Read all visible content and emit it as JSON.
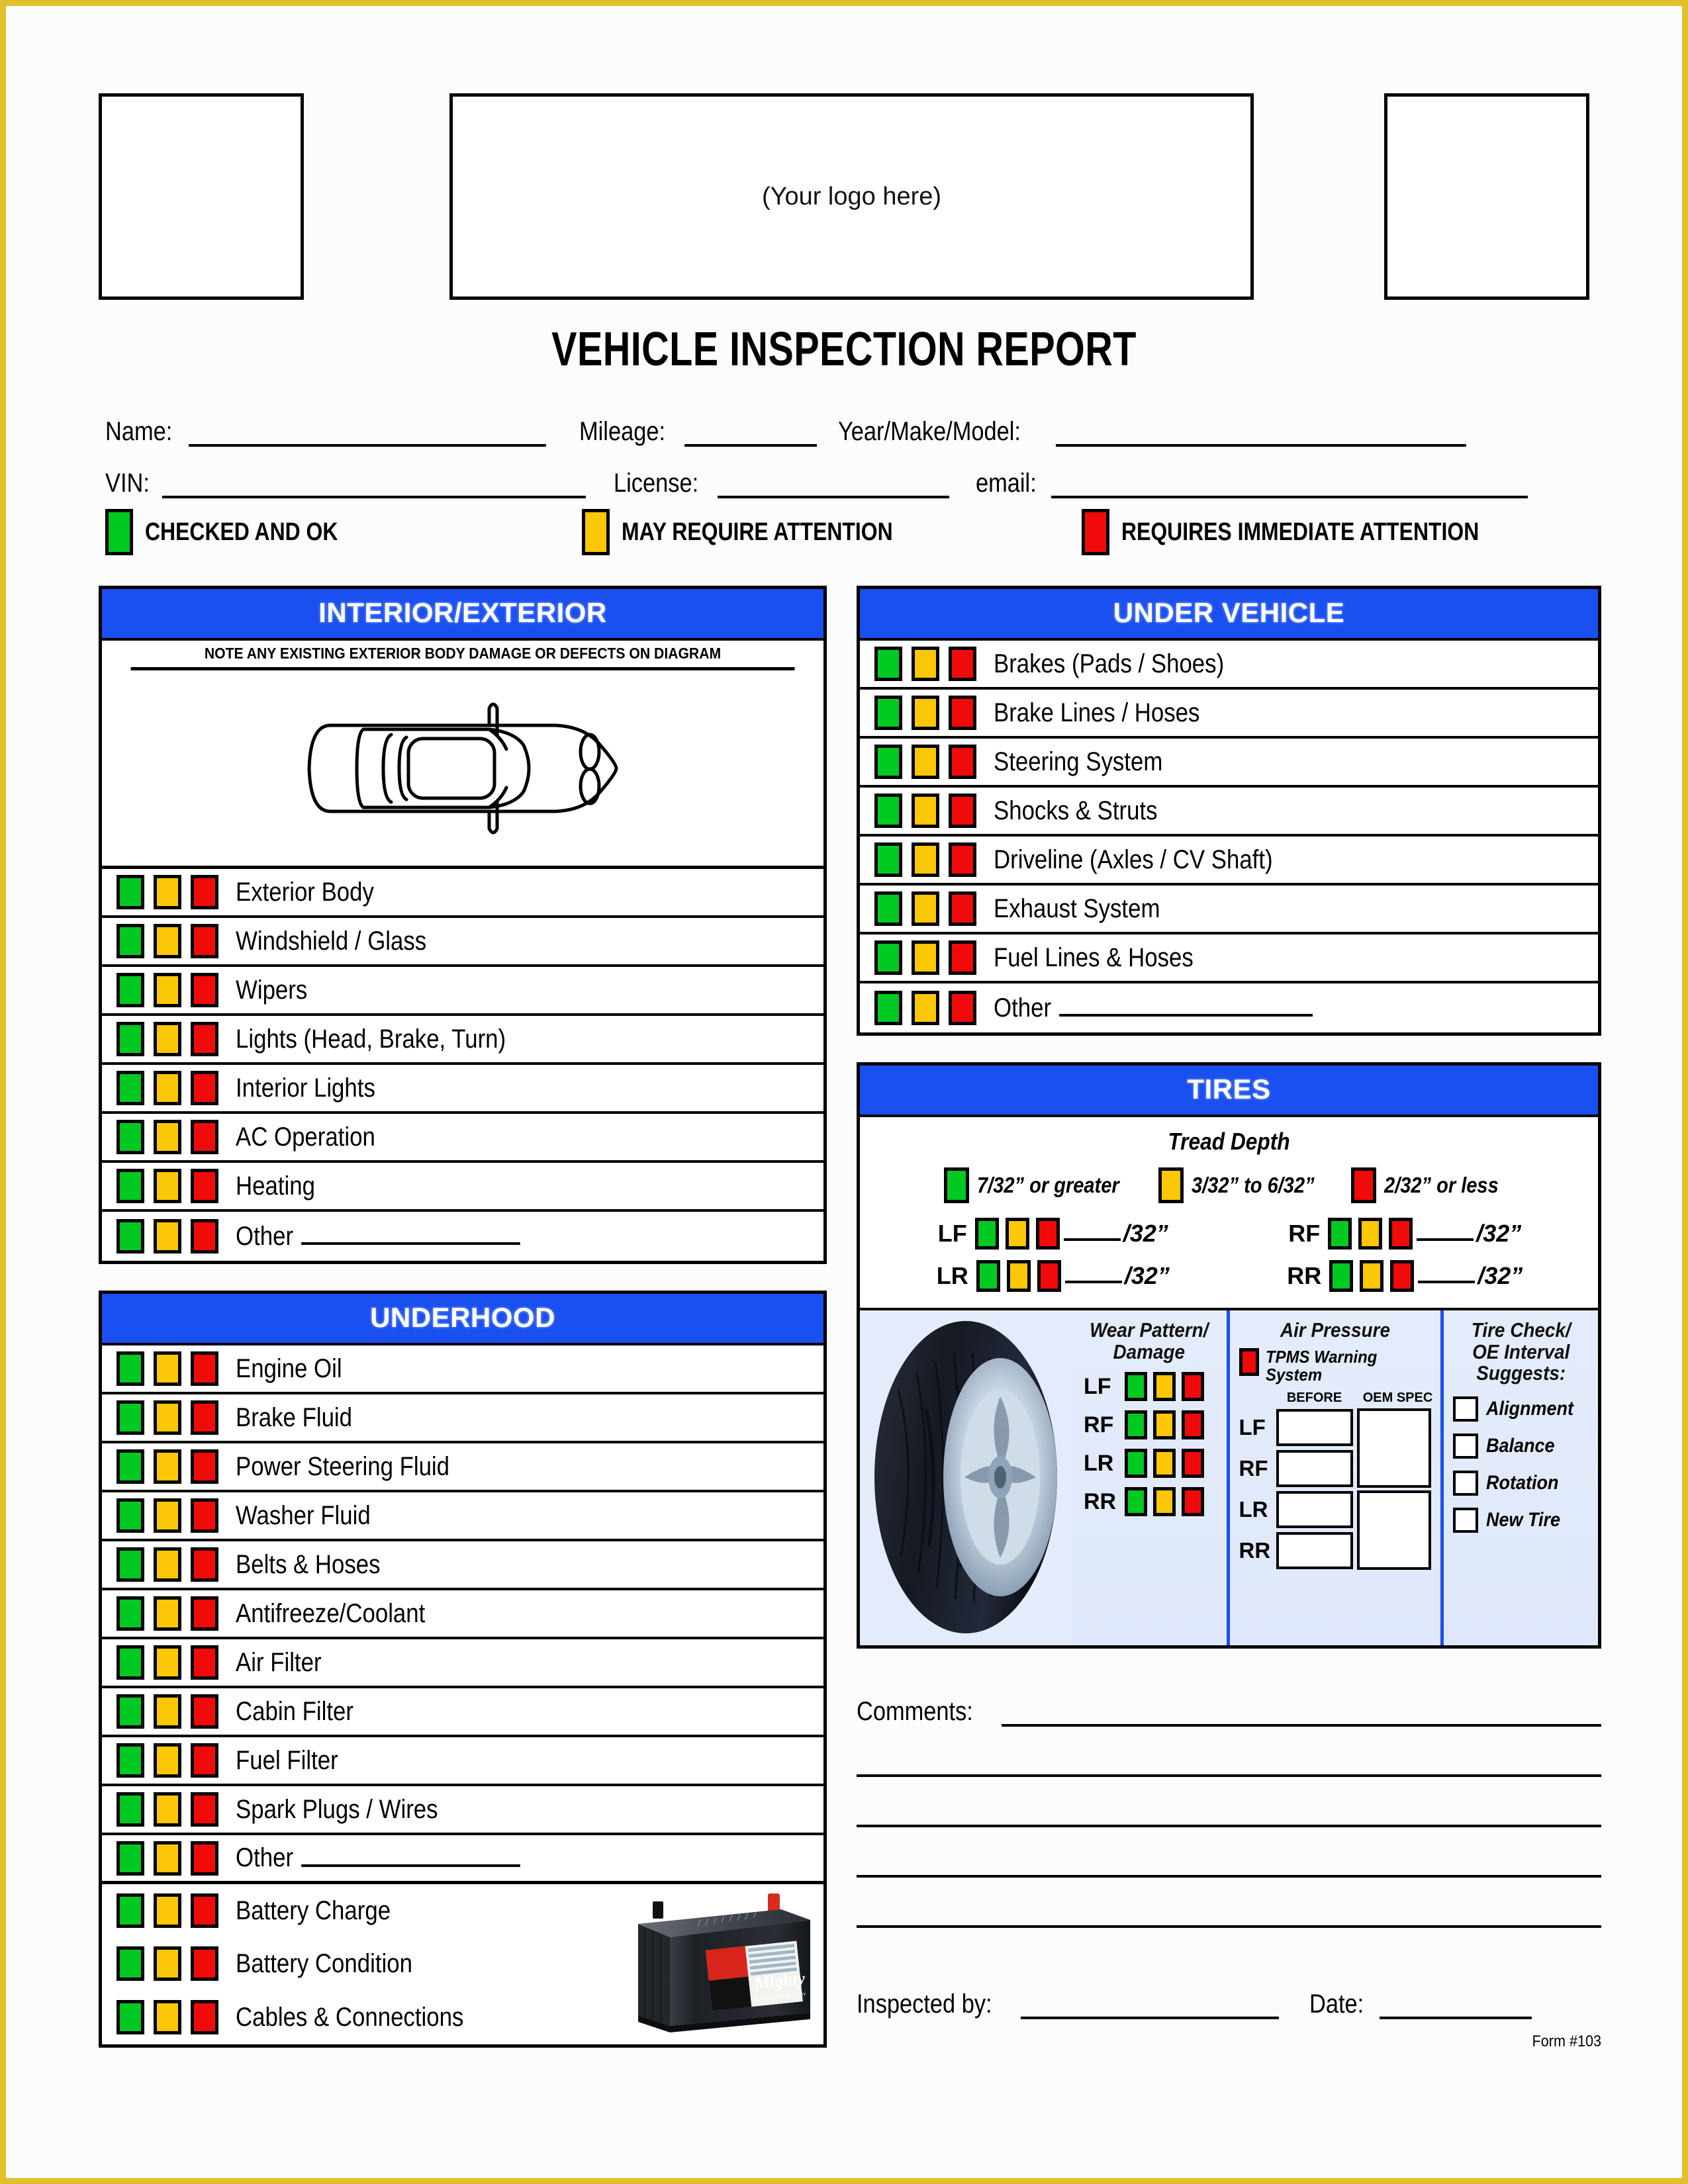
{
  "header": {
    "logo_placeholder": "(Your logo here)",
    "title": "VEHICLE INSPECTION REPORT"
  },
  "fields": {
    "name": "Name:",
    "mileage": "Mileage:",
    "year_make_model": "Year/Make/Model:",
    "vin": "VIN:",
    "license": "License:",
    "email": "email:"
  },
  "legend": [
    {
      "label": "CHECKED AND OK",
      "color": "#00c922"
    },
    {
      "label": "MAY REQUIRE ATTENTION",
      "color": "#fcc706"
    },
    {
      "label": "REQUIRES IMMEDIATE ATTENTION",
      "color": "#f00a0a"
    }
  ],
  "colors": {
    "green": "#00c922",
    "yellow": "#fcc706",
    "red": "#f00a0a",
    "header_blue": "#1a4ff0",
    "page_border": "#e0c02a",
    "tire_panel_bg": "#e4ecfb"
  },
  "interior_exterior": {
    "title": "INTERIOR/EXTERIOR",
    "note": "NOTE ANY EXISTING EXTERIOR BODY DAMAGE OR DEFECTS ON DIAGRAM",
    "items": [
      "Exterior Body",
      "Windshield / Glass",
      "Wipers",
      "Lights (Head, Brake, Turn)",
      "Interior Lights",
      "AC Operation",
      "Heating",
      "Other"
    ]
  },
  "underhood": {
    "title": "UNDERHOOD",
    "items": [
      "Engine Oil",
      "Brake Fluid",
      "Power Steering Fluid",
      "Washer Fluid",
      "Belts & Hoses",
      "Antifreeze/Coolant",
      "Air Filter",
      "Cabin Filter",
      "Fuel Filter",
      "Spark Plugs / Wires",
      "Other"
    ],
    "battery_items": [
      "Battery Charge",
      "Battery Condition",
      "Cables & Connections"
    ],
    "battery_brand": "Mighty",
    "battery_sub": "AUTOMOTIVE BATTERY"
  },
  "under_vehicle": {
    "title": "UNDER VEHICLE",
    "items": [
      "Brakes (Pads / Shoes)",
      "Brake Lines / Hoses",
      "Steering System",
      "Shocks & Struts",
      "Driveline (Axles / CV Shaft)",
      "Exhaust System",
      "Fuel Lines & Hoses",
      "Other"
    ]
  },
  "tires": {
    "title": "TIRES",
    "tread_depth_title": "Tread Depth",
    "tread_legend": [
      {
        "label": "7/32” or greater",
        "color": "#00c922"
      },
      {
        "label": "3/32” to 6/32”",
        "color": "#fcc706"
      },
      {
        "label": "2/32” or less",
        "color": "#f00a0a"
      }
    ],
    "positions": [
      "LF",
      "RF",
      "LR",
      "RR"
    ],
    "tread_unit": "/32”",
    "wear_pattern_title": "Wear Pattern/ Damage",
    "air_pressure_title": "Air Pressure",
    "tpms_label": "TPMS Warning System",
    "pressure_col_before": "BEFORE",
    "pressure_col_oem": "OEM SPEC",
    "tire_check_title": "Tire Check/ OE Interval Suggests:",
    "suggestions": [
      "Alignment",
      "Balance",
      "Rotation",
      "New Tire"
    ]
  },
  "footer": {
    "comments_label": "Comments:",
    "inspected_by_label": "Inspected by:",
    "date_label": "Date:",
    "form_number": "Form #103"
  }
}
